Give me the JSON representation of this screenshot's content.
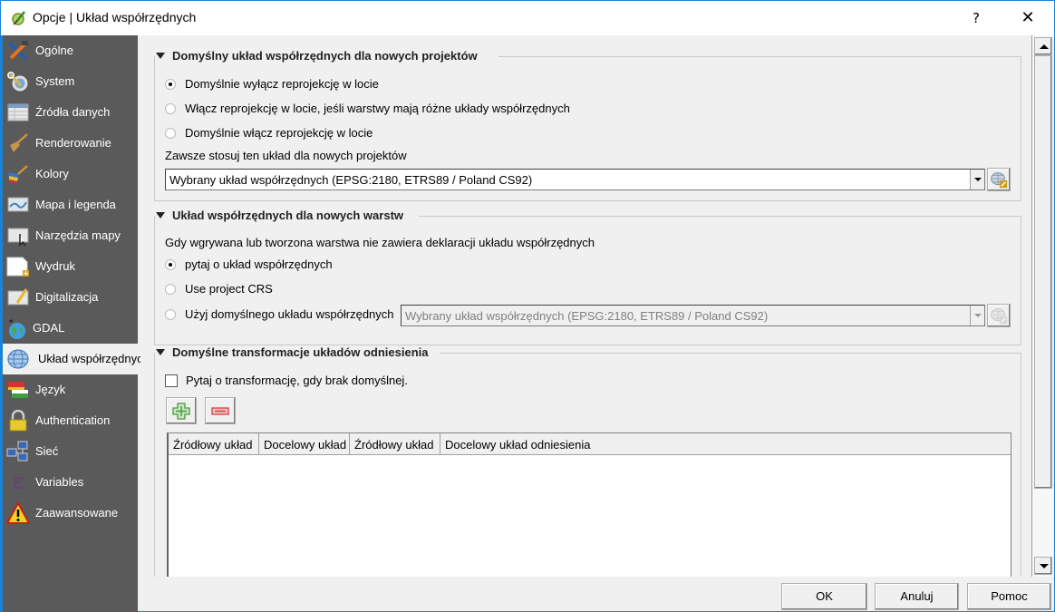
{
  "window": {
    "title": "Opcje | Układ współrzędnych",
    "help_label": "?",
    "close_label": "✕"
  },
  "sidebar": {
    "items": [
      {
        "label": "Ogólne",
        "icon": "tools-icon"
      },
      {
        "label": "System",
        "icon": "system-gear-icon"
      },
      {
        "label": "Źródła danych",
        "icon": "table-icon"
      },
      {
        "label": "Renderowanie",
        "icon": "brush-icon"
      },
      {
        "label": "Kolory",
        "icon": "color-brush-icon"
      },
      {
        "label": "Mapa i legenda",
        "icon": "map-legend-icon"
      },
      {
        "label": "Narzędzia mapy",
        "icon": "map-tools-icon"
      },
      {
        "label": "Wydruk",
        "icon": "print-layout-icon"
      },
      {
        "label": "Digitalizacja",
        "icon": "digitize-icon"
      },
      {
        "label": "GDAL",
        "icon": "gdal-globe-icon"
      },
      {
        "label": "Układ współrzędnych",
        "icon": "crs-globe-icon",
        "active": true
      },
      {
        "label": "Język",
        "icon": "language-flag-icon"
      },
      {
        "label": "Authentication",
        "icon": "lock-icon"
      },
      {
        "label": "Sieć",
        "icon": "network-icon"
      },
      {
        "label": "Variables",
        "icon": "epsilon-icon"
      },
      {
        "label": "Zaawansowane",
        "icon": "warning-icon"
      }
    ]
  },
  "project_crs": {
    "title": "Domyślny układ współrzędnych dla nowych projektów",
    "options": [
      {
        "label": "Domyślnie wyłącz reprojekcję w locie",
        "checked": true
      },
      {
        "label": "Włącz reprojekcję w locie, jeśli warstwy mają różne układy współrzędnych",
        "checked": false
      },
      {
        "label": "Domyślnie włącz reprojekcję w locie",
        "checked": false
      }
    ],
    "always_label": "Zawsze stosuj ten układ dla nowych projektów",
    "crs_value": "Wybrany układ współrzędnych (EPSG:2180, ETRS89 / Poland CS92)"
  },
  "layer_crs": {
    "title": "Układ współrzędnych dla nowych warstw",
    "description": "Gdy wgrywana lub tworzona warstwa nie zawiera deklaracji układu współrzędnych",
    "options": [
      {
        "label": "pytaj o układ współrzędnych",
        "checked": true
      },
      {
        "label": "Use project CRS",
        "checked": false
      },
      {
        "label": "Użyj domyślnego układu współrzędnych",
        "checked": false
      }
    ],
    "default_crs_value": "Wybrany układ współrzędnych (EPSG:2180, ETRS89 / Poland CS92)"
  },
  "transforms": {
    "title": "Domyślne transformacje układów odniesienia",
    "ask_label": "Pytaj o transformację, gdy brak domyślnej.",
    "ask_checked": false,
    "columns": [
      "Źródłowy układ",
      "Docelowy układ",
      "Źródłowy układ",
      "Docelowy układ odniesienia"
    ],
    "rows": []
  },
  "footer": {
    "ok_label": "OK",
    "cancel_label": "Anuluj",
    "help_label": "Pomoc"
  }
}
